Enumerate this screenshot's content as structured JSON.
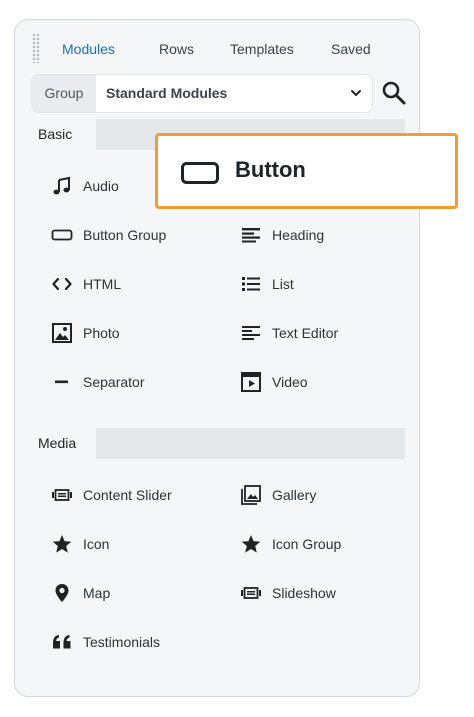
{
  "tabs": [
    {
      "label": "Modules",
      "active": true
    },
    {
      "label": "Rows",
      "active": false
    },
    {
      "label": "Templates",
      "active": false
    },
    {
      "label": "Saved",
      "active": false
    }
  ],
  "group": {
    "label": "Group",
    "selected": "Standard Modules"
  },
  "sections": {
    "basic": {
      "title": "Basic",
      "items": [
        {
          "label": "Audio",
          "icon": "music-note-icon"
        },
        {
          "label": "Button Group",
          "icon": "button-group-icon"
        },
        {
          "label": "Heading",
          "icon": "heading-icon"
        },
        {
          "label": "HTML",
          "icon": "code-icon"
        },
        {
          "label": "List",
          "icon": "list-icon"
        },
        {
          "label": "Photo",
          "icon": "photo-icon"
        },
        {
          "label": "Text Editor",
          "icon": "text-editor-icon"
        },
        {
          "label": "Separator",
          "icon": "separator-icon"
        },
        {
          "label": "Video",
          "icon": "video-icon"
        }
      ]
    },
    "media": {
      "title": "Media",
      "items": [
        {
          "label": "Content Slider",
          "icon": "slider-icon"
        },
        {
          "label": "Gallery",
          "icon": "gallery-icon"
        },
        {
          "label": "Icon",
          "icon": "star-icon"
        },
        {
          "label": "Icon Group",
          "icon": "star-icon"
        },
        {
          "label": "Map",
          "icon": "map-pin-icon"
        },
        {
          "label": "Slideshow",
          "icon": "slideshow-icon"
        },
        {
          "label": "Testimonials",
          "icon": "quote-icon"
        }
      ]
    }
  },
  "drag_preview": {
    "label": "Button",
    "icon": "button-icon"
  },
  "colors": {
    "accent": "#1f6fb8",
    "highlight": "#f29d32",
    "panel": "#f5f6f8"
  }
}
